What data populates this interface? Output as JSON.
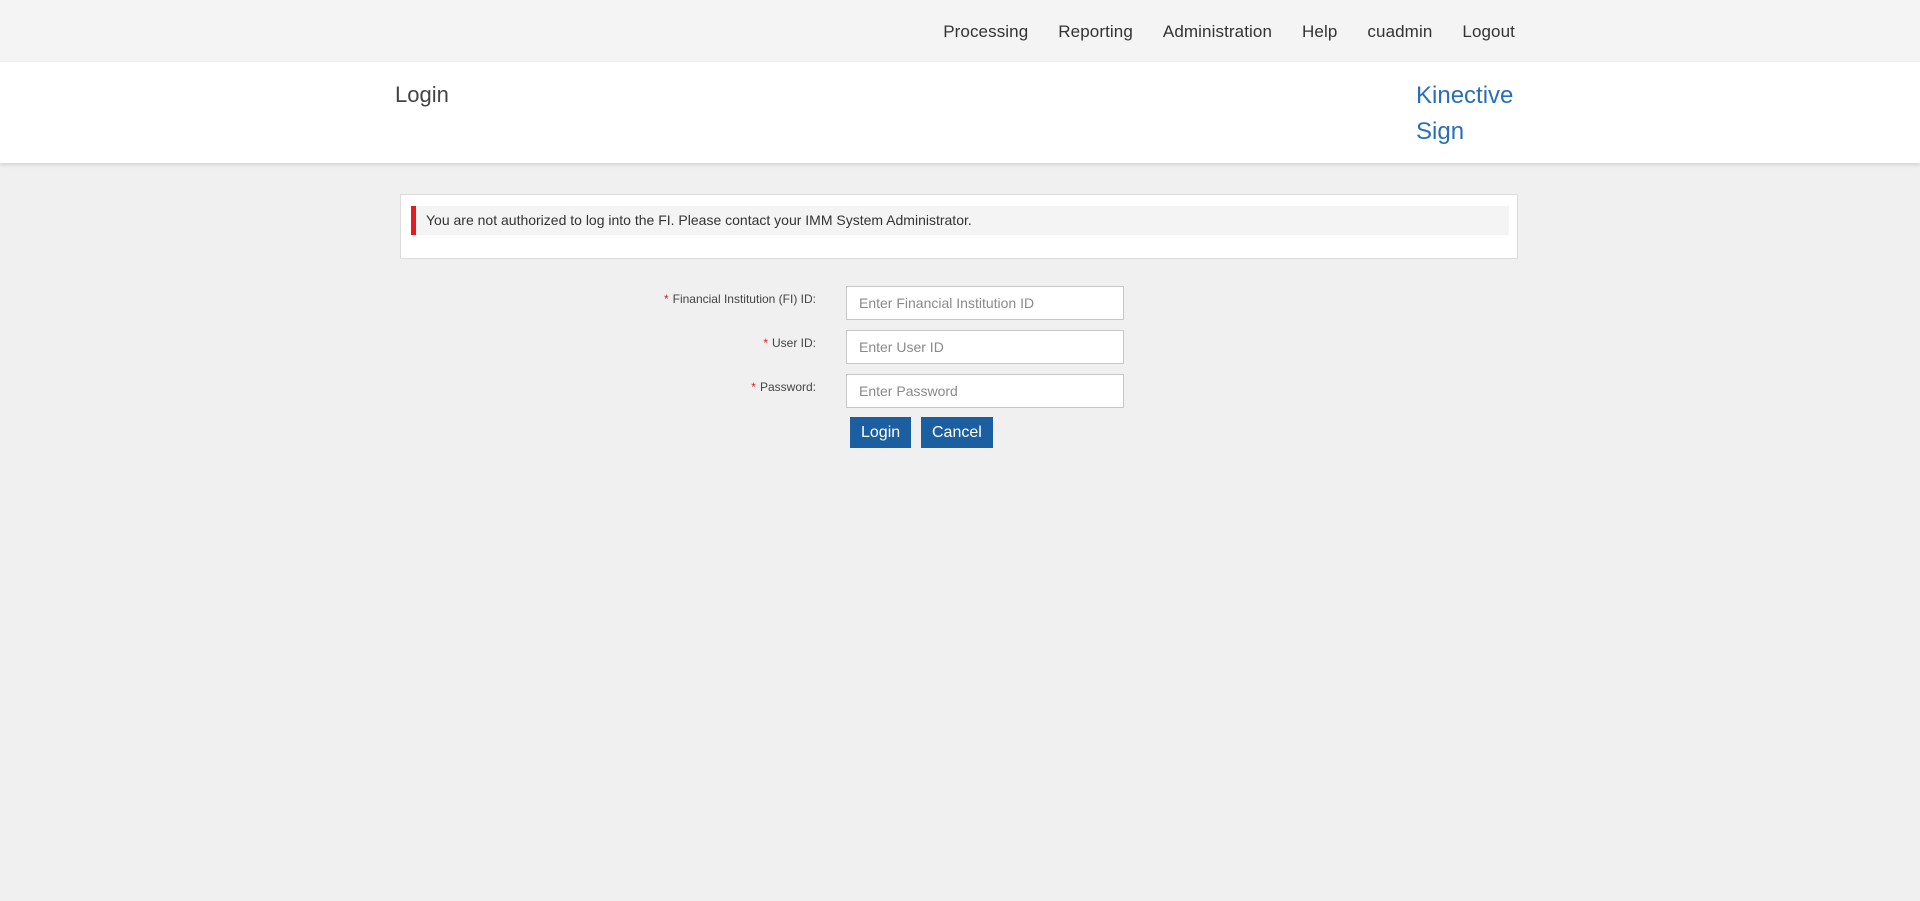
{
  "nav": {
    "items": [
      {
        "label": "Processing"
      },
      {
        "label": "Reporting"
      },
      {
        "label": "Administration"
      },
      {
        "label": "Help"
      },
      {
        "label": "cuadmin"
      },
      {
        "label": "Logout"
      }
    ]
  },
  "header": {
    "title": "Login",
    "brand_line1": "Kinective",
    "brand_line2": "Sign",
    "brand_color": "#2a6ebb"
  },
  "alert": {
    "message": "You are not authorized to log into the FI. Please contact your IMM System Administrator.",
    "accent_color": "#e31b23"
  },
  "form": {
    "required_marker": "*",
    "fi_id": {
      "label": "Financial Institution (FI) ID:",
      "placeholder": "Enter Financial Institution ID",
      "value": ""
    },
    "user_id": {
      "label": "User ID:",
      "placeholder": "Enter User ID",
      "value": ""
    },
    "password": {
      "label": "Password:",
      "placeholder": "Enter Password",
      "value": ""
    },
    "login_label": "Login",
    "cancel_label": "Cancel",
    "button_color": "#1b5fa0"
  }
}
